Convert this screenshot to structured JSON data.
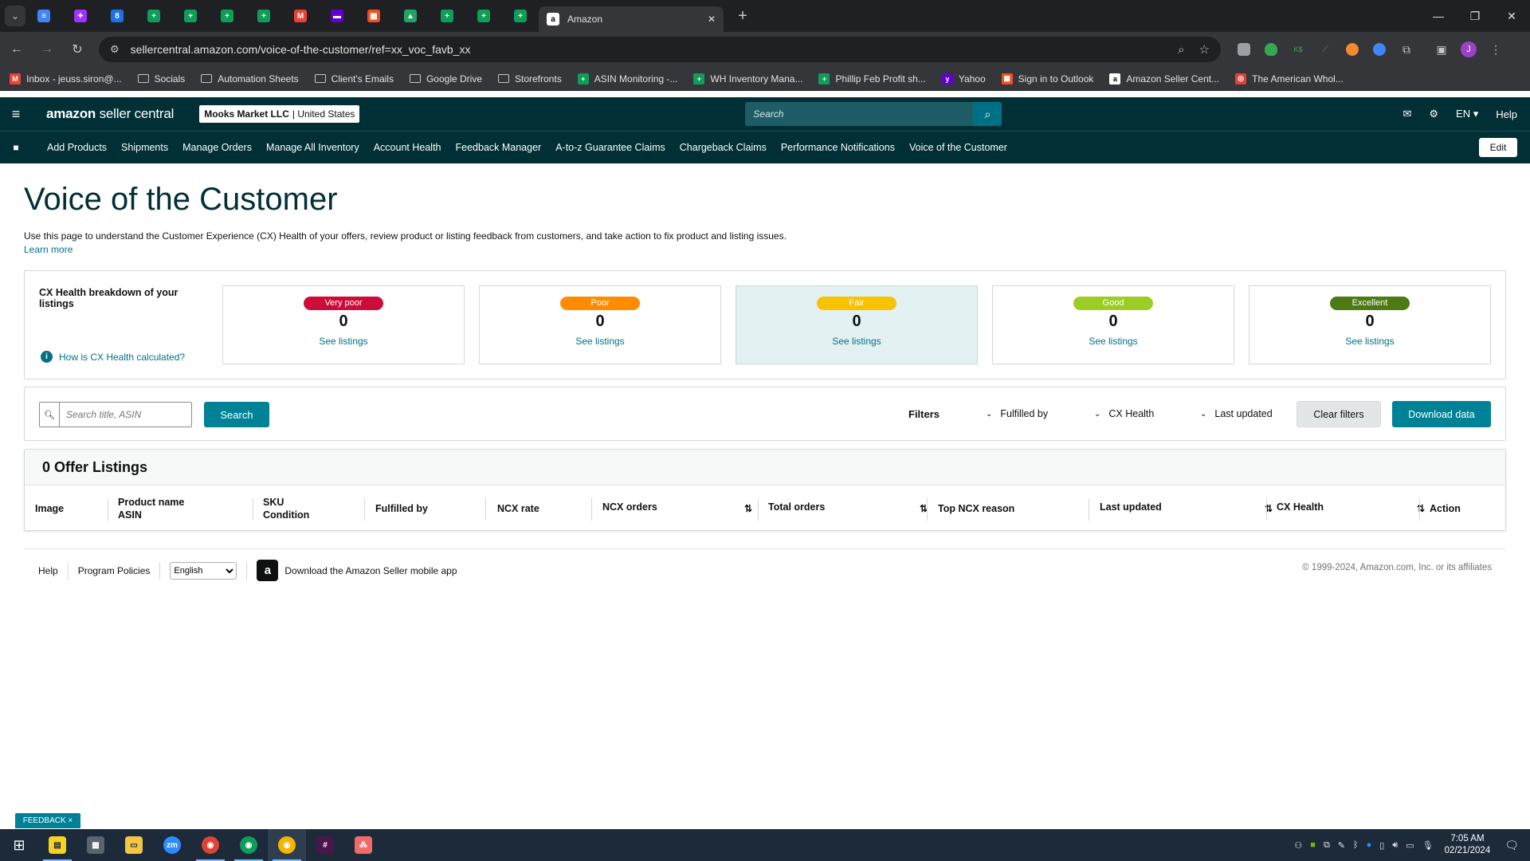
{
  "browser": {
    "pinned_tabs": [
      {
        "icon": "google-docs-icon",
        "color": "#4285f4",
        "glyph": "≡"
      },
      {
        "icon": "messenger-icon",
        "color": "#a033ff",
        "glyph": "✦"
      },
      {
        "icon": "badge-icon",
        "color": "#1a73e8",
        "glyph": "8"
      },
      {
        "icon": "google-sheets-icon",
        "color": "#0f9d58",
        "glyph": "+"
      },
      {
        "icon": "google-sheets-icon",
        "color": "#0f9d58",
        "glyph": "+"
      },
      {
        "icon": "google-sheets-icon",
        "color": "#0f9d58",
        "glyph": "+"
      },
      {
        "icon": "google-sheets-icon",
        "color": "#0f9d58",
        "glyph": "+"
      },
      {
        "icon": "gmail-icon",
        "color": "#ea4335",
        "glyph": "M"
      },
      {
        "icon": "yahoo-mail-icon",
        "color": "#6001d2",
        "glyph": "▬"
      },
      {
        "icon": "microsoft-icon",
        "color": "#f25022",
        "glyph": "▦"
      },
      {
        "icon": "google-drive-icon",
        "color": "#1fa463",
        "glyph": "▲"
      },
      {
        "icon": "google-sheets-icon",
        "color": "#0f9d58",
        "glyph": "+"
      },
      {
        "icon": "google-sheets-icon",
        "color": "#0f9d58",
        "glyph": "+"
      },
      {
        "icon": "google-sheets-icon",
        "color": "#0f9d58",
        "glyph": "+"
      }
    ],
    "active_tab": "Amazon",
    "url": "sellercentral.amazon.com/voice-of-the-customer/ref=xx_voc_favb_xx",
    "bookmarks": [
      {
        "label": "Inbox - jeuss.siron@...",
        "type": "gmail"
      },
      {
        "label": "Socials",
        "type": "folder"
      },
      {
        "label": "Automation Sheets",
        "type": "folder"
      },
      {
        "label": "Client's Emails",
        "type": "folder"
      },
      {
        "label": "Google Drive",
        "type": "folder"
      },
      {
        "label": "Storefronts",
        "type": "folder"
      },
      {
        "label": "ASIN Monitoring -...",
        "type": "sheets"
      },
      {
        "label": "WH Inventory Mana...",
        "type": "sheets"
      },
      {
        "label": "Phillip Feb Profit sh...",
        "type": "sheets"
      },
      {
        "label": "Yahoo",
        "type": "yahoo"
      },
      {
        "label": "Sign in to Outlook",
        "type": "microsoft"
      },
      {
        "label": "Amazon Seller Cent...",
        "type": "amazon"
      },
      {
        "label": "The American Whol...",
        "type": "other"
      }
    ]
  },
  "header": {
    "logo_bold": "amazon",
    "logo_light": " seller central",
    "merchant_name": "Mooks Market LLC",
    "merchant_region": "| United States",
    "search_placeholder": "Search",
    "language": "EN ▾",
    "help": "Help"
  },
  "nav": {
    "items": [
      "Add Products",
      "Shipments",
      "Manage Orders",
      "Manage All Inventory",
      "Account Health",
      "Feedback Manager",
      "A-to-z Guarantee Claims",
      "Chargeback Claims",
      "Performance Notifications",
      "Voice of the Customer"
    ],
    "edit": "Edit"
  },
  "page": {
    "title": "Voice of the Customer",
    "description": "Use this page to understand the Customer Experience (CX) Health of your offers, review product or listing feedback from customers, and take action to fix product and listing issues.",
    "learn_more": "Learn more"
  },
  "health": {
    "title": "CX Health breakdown of your listings",
    "how_link": "How is CX Health calculated?",
    "categories": [
      {
        "label": "Very poor",
        "count": "0",
        "link": "See listings",
        "color": "#cc0c39"
      },
      {
        "label": "Poor",
        "count": "0",
        "link": "See listings",
        "color": "#ff8c00"
      },
      {
        "label": "Fair",
        "count": "0",
        "link": "See listings",
        "color": "#f7c300"
      },
      {
        "label": "Good",
        "count": "0",
        "link": "See listings",
        "color": "#9bcd24"
      },
      {
        "label": "Excellent",
        "count": "0",
        "link": "See listings",
        "color": "#4d7a12"
      }
    ]
  },
  "filters": {
    "search_placeholder": "Search title, ASIN",
    "search_button": "Search",
    "filters_label": "Filters",
    "fulfilled_by": "Fulfilled by",
    "cx_health": "CX Health",
    "last_updated": "Last updated",
    "clear": "Clear filters",
    "download": "Download data"
  },
  "table": {
    "heading": "0 Offer Listings",
    "columns": {
      "image": "Image",
      "product_name": "Product name",
      "asin": "ASIN",
      "sku": "SKU",
      "condition": "Condition",
      "fulfilled_by": "Fulfilled by",
      "ncx_rate": "NCX rate",
      "ncx_orders": "NCX orders",
      "total_orders": "Total orders",
      "top_reason": "Top NCX reason",
      "last_updated": "Last updated",
      "cx_health": "CX Health",
      "action": "Action"
    }
  },
  "footer": {
    "help": "Help",
    "policies": "Program Policies",
    "language": "English",
    "app_link": "Download the Amazon Seller mobile app",
    "copyright": "© 1999-2024, Amazon.com, Inc. or its affiliates"
  },
  "feedback": "FEEDBACK ×",
  "taskbar": {
    "time": "7:05 AM",
    "date": "02/21/2024"
  }
}
